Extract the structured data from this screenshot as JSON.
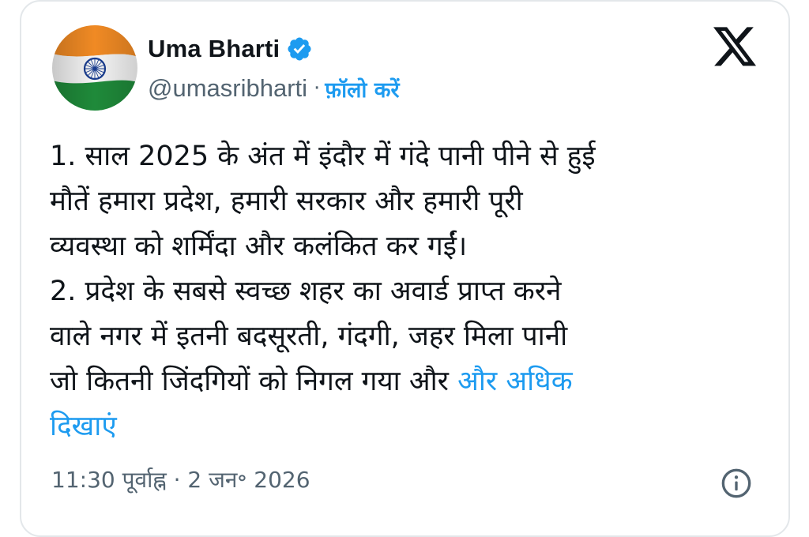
{
  "author": {
    "name": "Uma Bharti",
    "handle": "@umasribharti",
    "separator": "·",
    "follow_label": "फ़ॉलो करें",
    "verified": true
  },
  "tweet": {
    "lines": [
      "1. साल 2025 के अंत में इंदौर में गंदे पानी पीने से हुई",
      "मौतें हमारा प्रदेश, हमारी सरकार और हमारी पूरी",
      "व्यवस्था को शर्मिंदा और कलंकित कर  गईं।",
      "2. प्रदेश के सबसे स्वच्छ शहर का अवार्ड प्राप्त करने",
      "वाले नगर में इतनी बदसूरती, गंदगी,  जहर मिला पानी",
      "जो कितनी जिंदगियों को निगल गया और "
    ],
    "show_more_part1": "और अधिक",
    "show_more_part2": "दिखाएं",
    "timestamp": "11:30 पूर्वाह्न · 2 जन॰ 2026"
  },
  "icons": {
    "avatar": "indian-flag-avatar",
    "verified": "verified-badge-icon",
    "brand": "x-logo-icon",
    "info": "info-icon"
  },
  "colors": {
    "link": "#1d9bf0",
    "text": "#0f1419",
    "muted": "#536471",
    "border": "#e3e7ea"
  }
}
